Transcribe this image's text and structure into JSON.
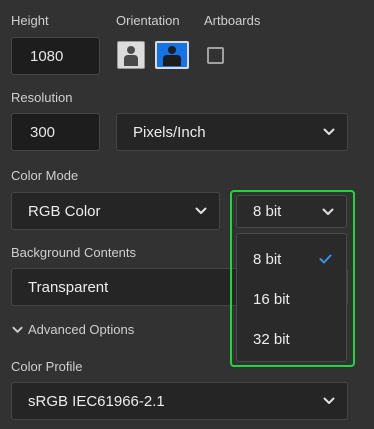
{
  "labels": {
    "height": "Height",
    "orientation": "Orientation",
    "artboards": "Artboards",
    "resolution": "Resolution",
    "color_mode": "Color Mode",
    "background_contents": "Background Contents",
    "advanced_options": "Advanced Options",
    "color_profile": "Color Profile"
  },
  "values": {
    "height": "1080",
    "resolution": "300",
    "resolution_unit": "Pixels/Inch",
    "color_mode": "RGB Color",
    "bit_depth": "8 bit",
    "background": "Transparent",
    "color_profile": "sRGB IEC61966-2.1"
  },
  "bit_depth_menu": {
    "options": [
      "8 bit",
      "16 bit",
      "32 bit"
    ],
    "selected_index": 0
  },
  "colors": {
    "accent": "#1473e6",
    "highlight": "#21d63b",
    "check": "#3b8fe8"
  }
}
